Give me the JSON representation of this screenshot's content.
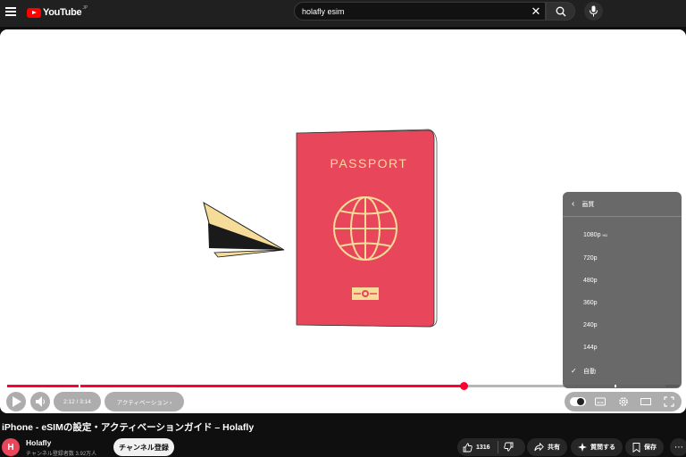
{
  "header": {
    "logo_text": "YouTube",
    "country_code": "JP",
    "search_value": "holafly esim",
    "icons": [
      "menu-icon",
      "youtube-logo",
      "clear-icon",
      "search-icon",
      "mic-icon"
    ]
  },
  "video_art": {
    "passport_text": "PASSPORT",
    "colors": {
      "passport": "#e8465b",
      "gold": "#f5dc98",
      "dark": "#1a1a1a"
    }
  },
  "player": {
    "time": "2:12 / 3:14",
    "chapter": "アクティベーション ›",
    "progress_played_fraction": 0.68,
    "progress_buffered_fraction": 0.98,
    "quality_menu": {
      "title": "画質",
      "options": [
        {
          "label": "1080p",
          "badge": "HD",
          "selected": false
        },
        {
          "label": "720p",
          "badge": "",
          "selected": false
        },
        {
          "label": "480p",
          "badge": "",
          "selected": false
        },
        {
          "label": "360p",
          "badge": "",
          "selected": false
        },
        {
          "label": "240p",
          "badge": "",
          "selected": false
        },
        {
          "label": "144p",
          "badge": "",
          "selected": false
        },
        {
          "label": "自動",
          "badge": "",
          "selected": true
        }
      ]
    },
    "control_icons": [
      "play-icon",
      "volume-icon",
      "autoplay-toggle",
      "subtitles-icon",
      "settings-icon",
      "theater-icon",
      "fullscreen-icon"
    ]
  },
  "video": {
    "title": "iPhone - eSIMの設定・アクティベーションガイド – Holafly",
    "channel": "Holafly",
    "avatar_letter": "H",
    "subscribers": "チャンネル登録者数 3.92万人",
    "subscribe_label": "チャンネル登録",
    "like_count": "1316",
    "share_label": "共有",
    "ask_label": "質問する",
    "save_label": "保存"
  },
  "colors": {
    "accent": "#ff0033",
    "brand": "#ff0000",
    "background": "#0f0f0f"
  }
}
